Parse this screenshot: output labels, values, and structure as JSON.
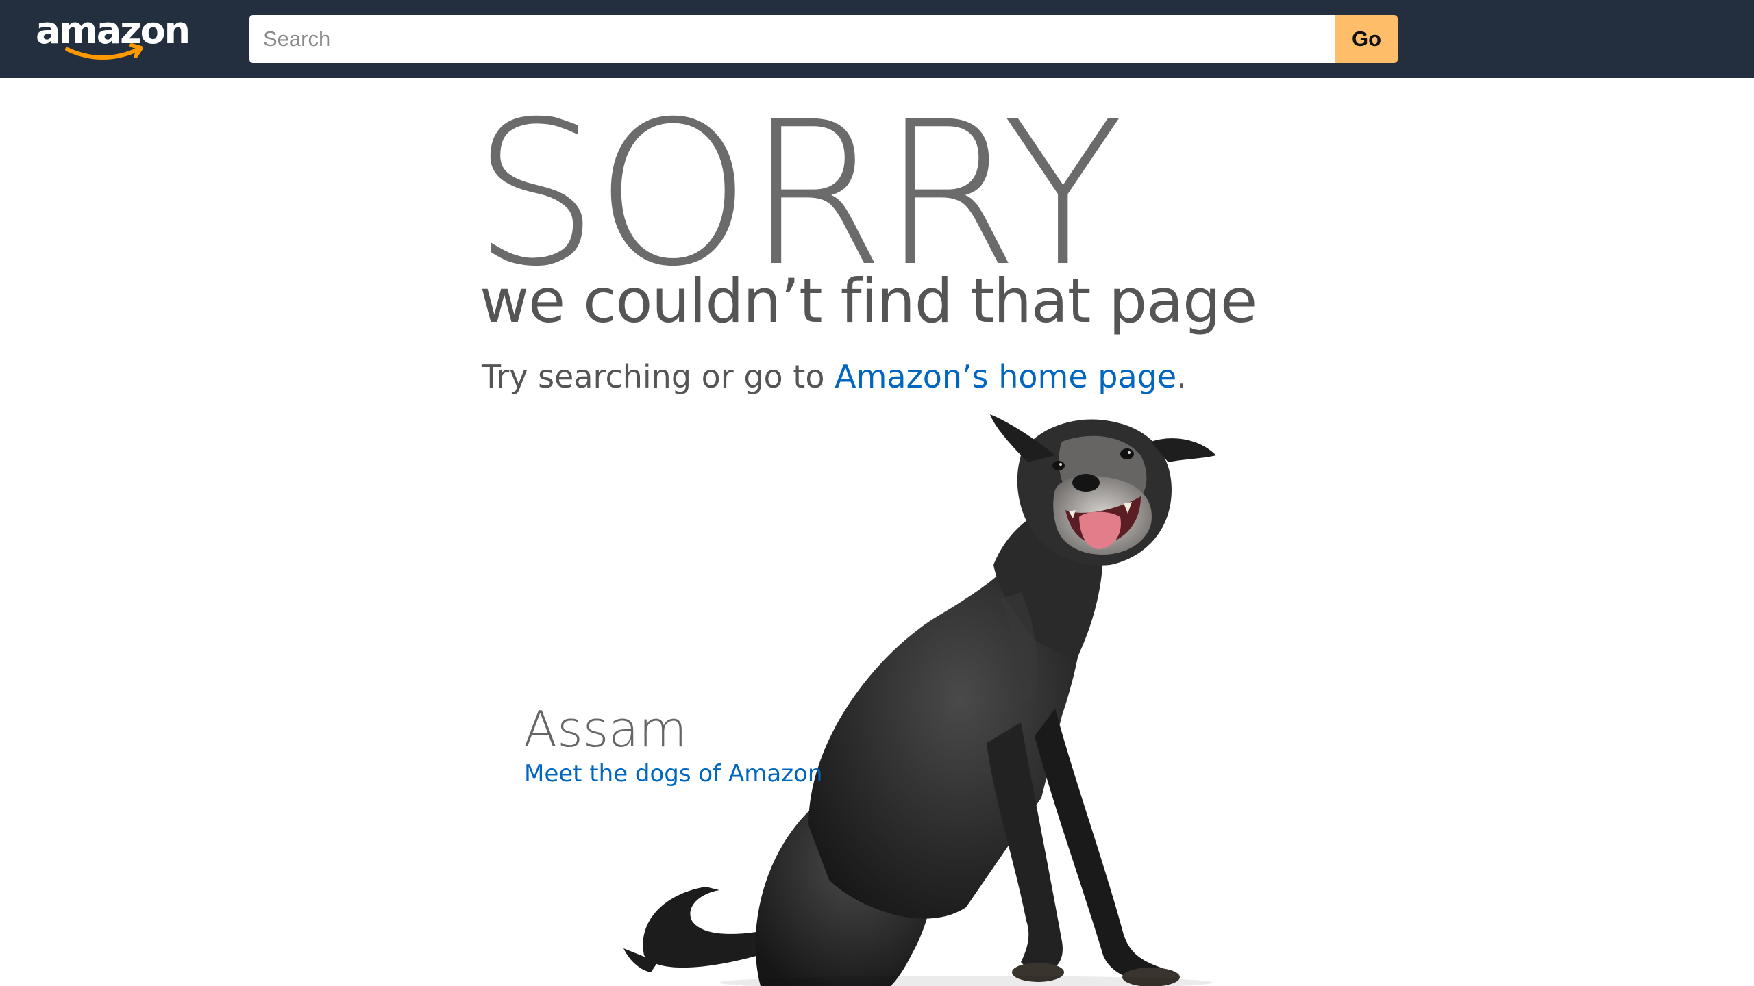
{
  "header": {
    "logo_text": "amazon",
    "search": {
      "placeholder": "Search",
      "value": ""
    },
    "go_label": "Go",
    "colors": {
      "bar": "#232f3e",
      "go_button": "#febd69",
      "logo_smile": "#ff9900"
    }
  },
  "message": {
    "title": "SORRY",
    "subtitle": "we couldn’t find that page",
    "try_prefix": "Try searching or go to ",
    "home_link": "Amazon’s home page",
    "try_suffix": ".",
    "link_color": "#0066c0"
  },
  "dog": {
    "name": "Assam",
    "link": "Meet the dogs of Amazon",
    "image_icon": "black-dog-photo"
  }
}
